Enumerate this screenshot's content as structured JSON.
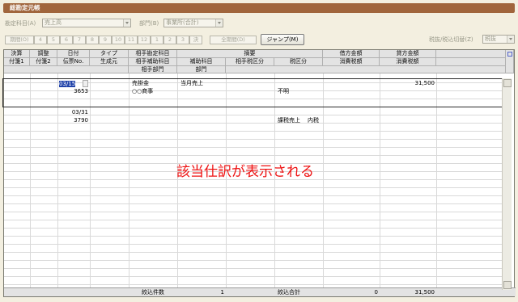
{
  "window": {
    "title": "総勘定元帳"
  },
  "filters": {
    "account_label": "勘定科目(A)",
    "account_value": "売上高",
    "dept_label": "部門(B)",
    "dept_value": "事業所(合計)",
    "tax_label": "税抜/税込切替(Z)",
    "tax_value": "税抜"
  },
  "periods": [
    "期間(O)",
    "4",
    "5",
    "6",
    "7",
    "8",
    "9",
    "10",
    "11",
    "12",
    "1",
    "2",
    "3",
    "決"
  ],
  "all_period_label": "全期間(D)",
  "jump_label": "ジャンプ(M)",
  "headers": {
    "settlement": "決算",
    "adjust": "調整",
    "date": "日付",
    "type": "タイプ",
    "counter_account": "相手勘定科目",
    "summary": "摘要",
    "debit": "借方金額",
    "credit": "貸方金額",
    "voucher1": "付箋1",
    "voucher2": "付箋2",
    "slip_no": "伝票No.",
    "origin": "生成元",
    "counter_sub": "相手補助科目",
    "sub_account": "補助科目",
    "counter_tax": "相手税区分",
    "tax_class": "税区分",
    "debit_tax": "消費税額",
    "credit_tax": "消費税額",
    "counter_dept": "相手部門",
    "dept": "部門"
  },
  "entries": [
    {
      "date": "03/15",
      "slip": "3653",
      "counter_account": "売掛金",
      "summary": "当月売上",
      "partner": "○○商事",
      "tax_class": "不明",
      "credit": "31,500"
    },
    {
      "date": "03/31",
      "slip": "3790",
      "tax_class": "課税売上",
      "tax_mode": "内税"
    }
  ],
  "overlay_text": "該当仕訳が表示される",
  "footer": {
    "count_label": "絞込件数",
    "count": "1",
    "total_label": "絞込合計",
    "debit_total": "0",
    "credit_total": "31,500"
  }
}
